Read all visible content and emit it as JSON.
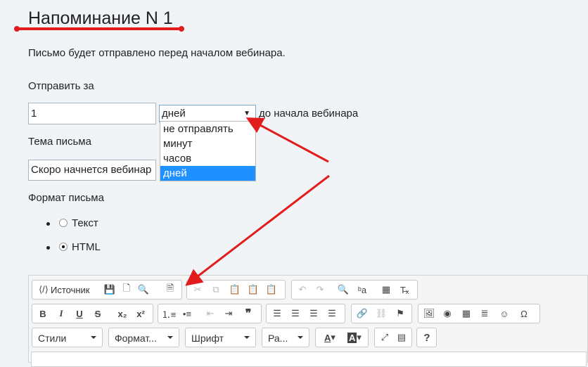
{
  "header": {
    "title": "Напоминание N 1"
  },
  "description": "Письмо будет отправлено перед началом вебинара.",
  "send_before": {
    "label": "Отправить за",
    "value": "1",
    "unit_selected": "дней",
    "suffix": "до начала вебинара",
    "options": [
      "не отправлять",
      "минут",
      "часов",
      "дней"
    ],
    "highlighted_option": "дней"
  },
  "subject": {
    "label": "Тема письма",
    "value": "Скоро начнется вебинар"
  },
  "format": {
    "label": "Формат письма",
    "options": [
      {
        "label": "Текст",
        "checked": false
      },
      {
        "label": "HTML",
        "checked": true
      }
    ]
  },
  "editor": {
    "source_button": "Источник",
    "styles_combo": "Стили",
    "format_combo": "Формат...",
    "font_combo": "Шрифт",
    "size_combo": "Ра...",
    "help_button": "?"
  },
  "colors": {
    "annotation": "#e21c1c",
    "highlight": "#1e90ff"
  }
}
